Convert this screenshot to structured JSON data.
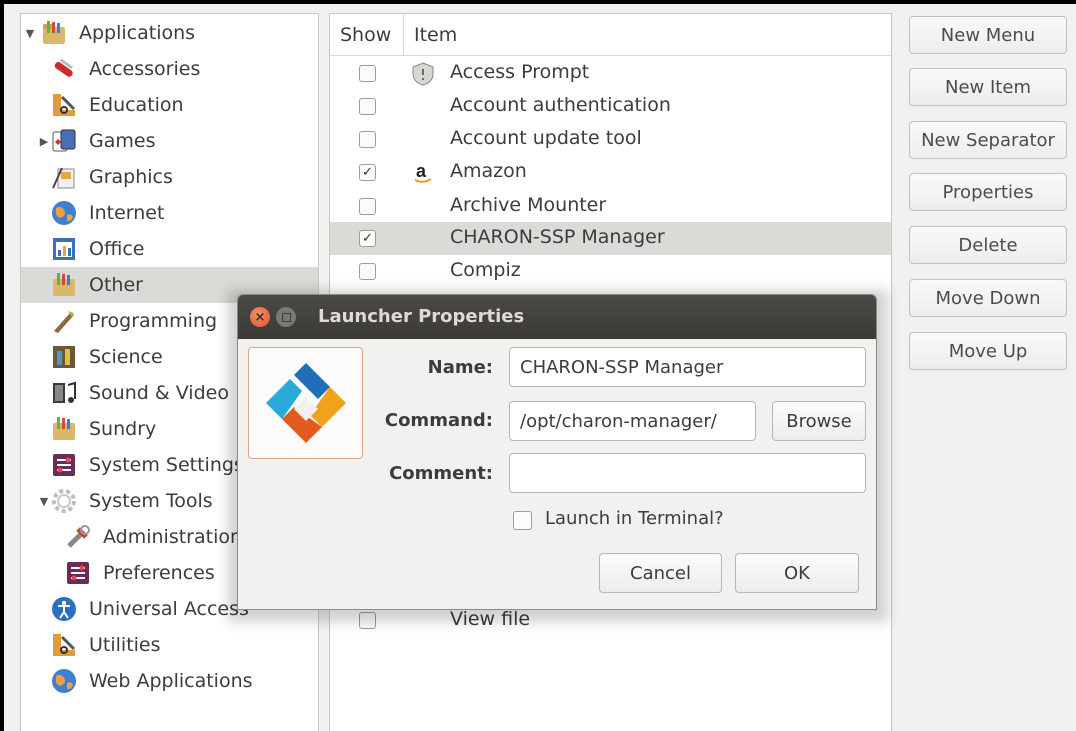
{
  "categories": [
    {
      "label": "Applications",
      "icon": "applications-folder-icon",
      "expander": "expanded",
      "indent": 0
    },
    {
      "label": "Accessories",
      "icon": "accessories-knife-icon",
      "expander": "",
      "indent": 1
    },
    {
      "label": "Education",
      "icon": "education-icon",
      "expander": "",
      "indent": 1
    },
    {
      "label": "Games",
      "icon": "games-cards-icon",
      "expander": "collapsed",
      "indent": 1
    },
    {
      "label": "Graphics",
      "icon": "graphics-icon",
      "expander": "",
      "indent": 1
    },
    {
      "label": "Internet",
      "icon": "internet-globe-icon",
      "expander": "",
      "indent": 1
    },
    {
      "label": "Office",
      "icon": "office-icon",
      "expander": "",
      "indent": 1
    },
    {
      "label": "Other",
      "icon": "other-folder-icon",
      "expander": "",
      "indent": 1,
      "selected": true
    },
    {
      "label": "Programming",
      "icon": "programming-icon",
      "expander": "",
      "indent": 1
    },
    {
      "label": "Science",
      "icon": "science-icon",
      "expander": "",
      "indent": 1
    },
    {
      "label": "Sound & Video",
      "icon": "sound-video-icon",
      "expander": "",
      "indent": 1
    },
    {
      "label": "Sundry",
      "icon": "sundry-folder-icon",
      "expander": "",
      "indent": 1
    },
    {
      "label": "System Settings",
      "icon": "system-settings-icon",
      "expander": "",
      "indent": 1
    },
    {
      "label": "System Tools",
      "icon": "system-tools-gear-icon",
      "expander": "expanded",
      "indent": 1
    },
    {
      "label": "Administration",
      "icon": "administration-icon",
      "expander": "",
      "indent": 2
    },
    {
      "label": "Preferences",
      "icon": "preferences-icon",
      "expander": "",
      "indent": 2
    },
    {
      "label": "Universal Access",
      "icon": "universal-access-icon",
      "expander": "",
      "indent": 1
    },
    {
      "label": "Utilities",
      "icon": "utilities-icon",
      "expander": "",
      "indent": 1
    },
    {
      "label": "Web Applications",
      "icon": "web-applications-globe-icon",
      "expander": "",
      "indent": 1
    }
  ],
  "list": {
    "header_show": "Show",
    "header_item": "Item",
    "items": [
      {
        "label": "Access Prompt",
        "checked": false,
        "icon": "shield-icon"
      },
      {
        "label": "Account authentication",
        "checked": false,
        "icon": ""
      },
      {
        "label": "Account update tool",
        "checked": false,
        "icon": ""
      },
      {
        "label": "Amazon",
        "checked": true,
        "icon": "amazon-icon"
      },
      {
        "label": "Archive Mounter",
        "checked": false,
        "icon": ""
      },
      {
        "label": "CHARON-SSP Manager",
        "checked": true,
        "icon": "",
        "selected": true
      },
      {
        "label": "Compiz",
        "checked": false,
        "icon": ""
      }
    ],
    "partial_item": {
      "label": "View file",
      "checked": false
    }
  },
  "side_buttons": [
    "New Menu",
    "New Item",
    "New Separator",
    "Properties",
    "Delete",
    "Move Down",
    "Move Up"
  ],
  "dialog": {
    "title": "Launcher Properties",
    "name_label": "Name:",
    "name_value": "CHARON-SSP Manager",
    "command_label": "Command:",
    "command_value": "/opt/charon-manager/",
    "browse_label": "Browse",
    "comment_label": "Comment:",
    "comment_value": "",
    "terminal_label": "Launch in Terminal?",
    "terminal_checked": false,
    "cancel_label": "Cancel",
    "ok_label": "OK",
    "icon": "charon-logo-icon"
  },
  "colors": {
    "selection": "#dcdad6",
    "titlebar": "#3c3b37",
    "close": "#e0542b"
  }
}
